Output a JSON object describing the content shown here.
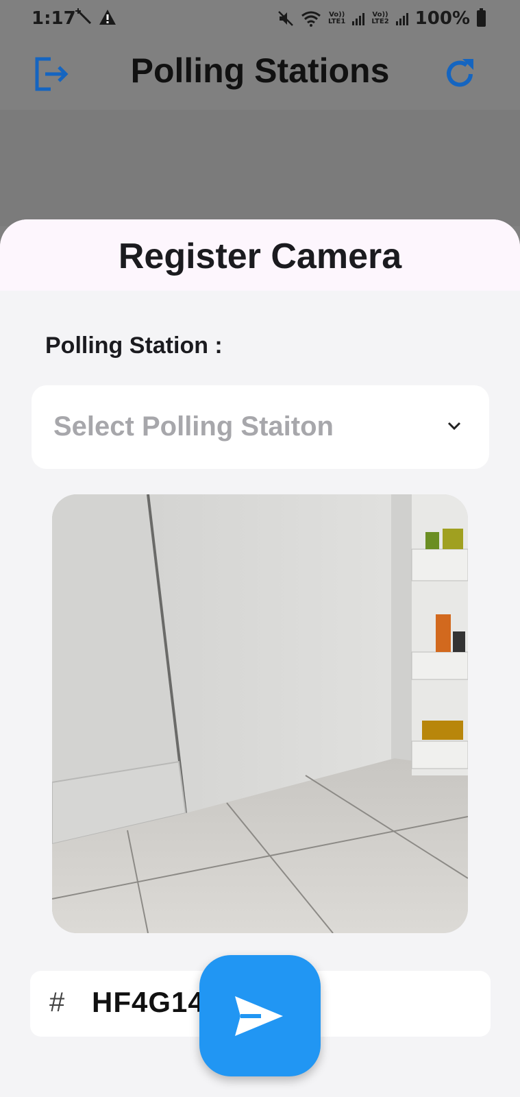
{
  "status_bar": {
    "time": "1:17",
    "sim1_label": "Vo))\nLTE1",
    "sim2_label": "Vo))\nLTE2",
    "battery": "100%"
  },
  "app_bar": {
    "title": "Polling Stations",
    "icons": [
      "logout-icon",
      "refresh-icon"
    ],
    "accent_color": "#1565c0"
  },
  "sheet": {
    "title": "Register Camera",
    "field_label": "Polling Station :",
    "select_placeholder": "Select Polling Staiton",
    "code_prefix": "#",
    "code_value": "HF4G14"
  },
  "fab": {
    "icon": "send-icon",
    "color": "#2196f3"
  }
}
